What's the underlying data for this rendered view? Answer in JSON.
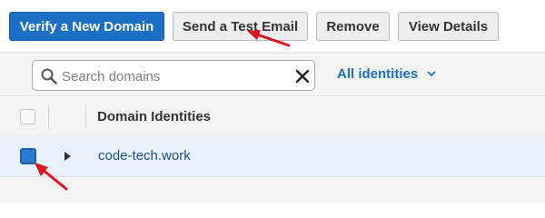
{
  "toolbar": {
    "verify_label": "Verify a New Domain",
    "test_email_label": "Send a Test Email",
    "remove_label": "Remove",
    "view_details_label": "View Details"
  },
  "search": {
    "placeholder": "Search domains",
    "value": ""
  },
  "filter": {
    "label": "All identities"
  },
  "table": {
    "header": "Domain Identities",
    "rows": [
      {
        "domain": "code-tech.work",
        "selected": true
      }
    ]
  },
  "colors": {
    "primary": "#1b6fc4",
    "link": "#1b4f8a",
    "annotation": "#e0141e"
  }
}
